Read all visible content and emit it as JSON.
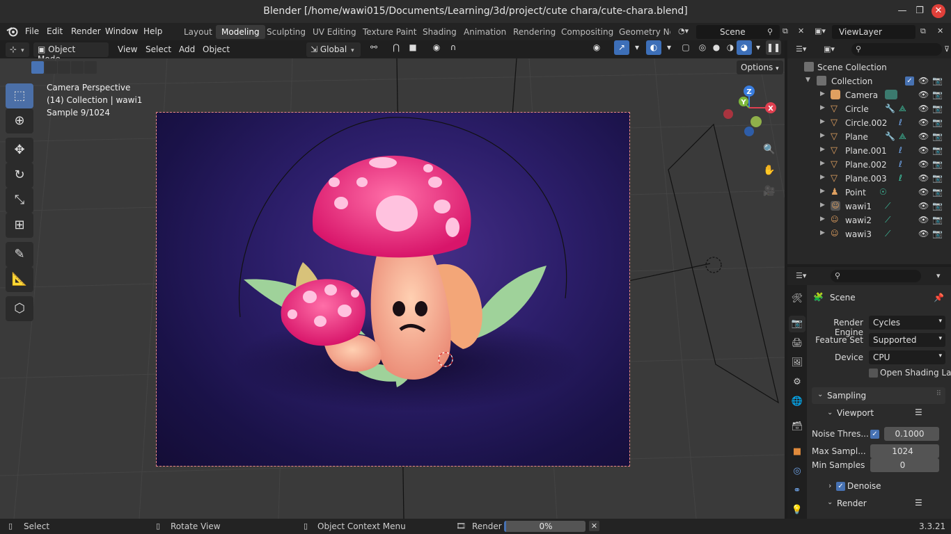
{
  "window": {
    "title": "Blender [/home/wawi015/Documents/Learning/3d/project/cute chara/cute-chara.blend]",
    "minimize": "—",
    "maximize": "❐",
    "close": "✕"
  },
  "menubar": {
    "items": [
      "File",
      "Edit",
      "Render",
      "Window",
      "Help"
    ],
    "workspaces": [
      "Layout",
      "Modeling",
      "Sculpting",
      "UV Editing",
      "Texture Paint",
      "Shading",
      "Animation",
      "Rendering",
      "Compositing",
      "Geometry Noc"
    ],
    "active_workspace": "Modeling",
    "scene": "Scene",
    "view_layer": "ViewLayer"
  },
  "viewport_header": {
    "mode": "Object Mode",
    "menus": [
      "View",
      "Select",
      "Add",
      "Object"
    ],
    "orientation": "Global",
    "options": "Options"
  },
  "viewport": {
    "overlay_lines": [
      "Camera Perspective",
      "(14) Collection | wawi1",
      "Sample 9/1024"
    ],
    "axis_labels": {
      "x": "X",
      "y": "Y",
      "z": "Z"
    }
  },
  "outliner": {
    "root": "Scene Collection",
    "collection": "Collection",
    "objects": [
      {
        "name": "Camera",
        "type": "camera"
      },
      {
        "name": "Circle",
        "type": "mesh"
      },
      {
        "name": "Circle.002",
        "type": "mesh"
      },
      {
        "name": "Plane",
        "type": "mesh"
      },
      {
        "name": "Plane.001",
        "type": "mesh"
      },
      {
        "name": "Plane.002",
        "type": "mesh"
      },
      {
        "name": "Plane.003",
        "type": "mesh"
      },
      {
        "name": "Point",
        "type": "light"
      },
      {
        "name": "wawi1",
        "type": "armature"
      },
      {
        "name": "wawi2",
        "type": "armature"
      },
      {
        "name": "wawi3",
        "type": "armature"
      }
    ]
  },
  "properties": {
    "context": "Scene",
    "render_engine_label": "Render Engine",
    "render_engine": "Cycles",
    "feature_set_label": "Feature Set",
    "feature_set": "Supported",
    "device_label": "Device",
    "device": "CPU",
    "osl_label": "Open Shading La...",
    "sampling": "Sampling",
    "viewport_section": "Viewport",
    "noise_threshold_label": "Noise Thres...",
    "noise_threshold": "0.1000",
    "max_samples_label": "Max Sampl...",
    "max_samples": "1024",
    "min_samples_label": "Min Samples",
    "min_samples": "0",
    "denoise": "Denoise",
    "render_section": "Render"
  },
  "statusbar": {
    "select": "Select",
    "rotate": "Rotate View",
    "context_menu": "Object Context Menu",
    "render_label": "Render",
    "progress_text": "0%",
    "progress_fraction": 0,
    "version": "3.3.21"
  },
  "colors": {
    "accent": "#4772b3",
    "mushroom_pink": "#ff3d8a",
    "stem_peach": "#f7b39a",
    "leaf_green": "#9fd29a",
    "background_purple": "#2c1e6a",
    "close_red": "#e0403a"
  }
}
